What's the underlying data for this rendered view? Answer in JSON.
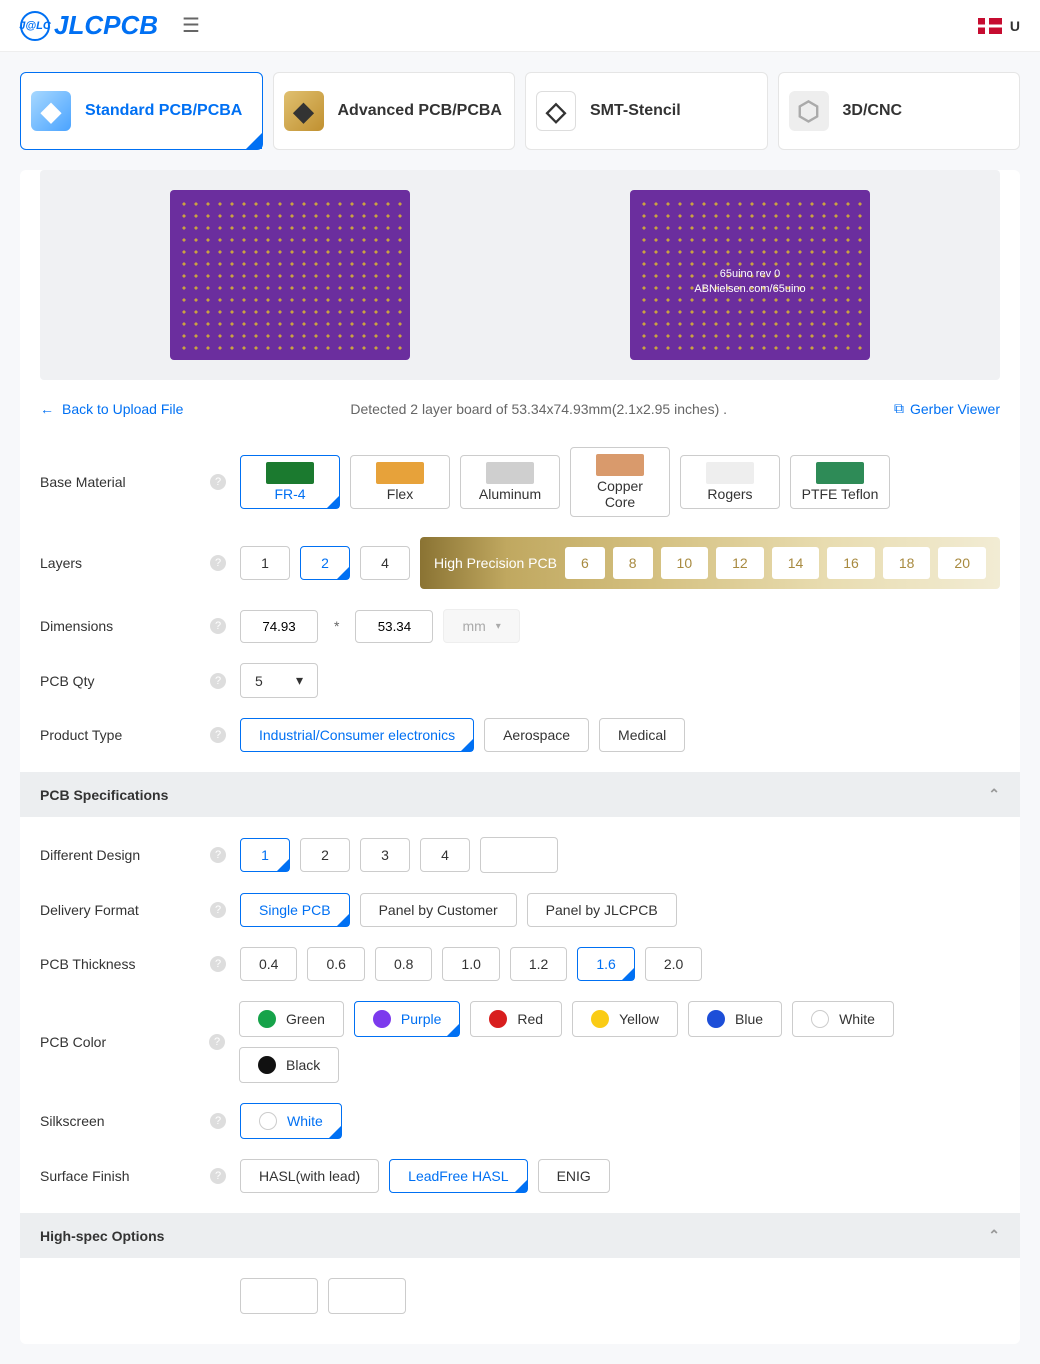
{
  "header": {
    "logo": "JLCPCB",
    "right": "U"
  },
  "tabs": [
    {
      "label": "Standard PCB/PCBA",
      "selected": true
    },
    {
      "label": "Advanced PCB/PCBA",
      "selected": false
    },
    {
      "label": "SMT-Stencil",
      "selected": false
    },
    {
      "label": "3D/CNC",
      "selected": false
    }
  ],
  "preview": {
    "rev_line1": "65uino rev 0",
    "rev_line2": "ABNielsen.com/65uino"
  },
  "meta": {
    "back": "Back to Upload File",
    "detected": "Detected 2 layer board of 53.34x74.93mm(2.1x2.95 inches) .",
    "viewer": "Gerber Viewer"
  },
  "materials_label": "Base Material",
  "materials": [
    {
      "label": "FR-4",
      "selected": true,
      "color": "#1b7a2f"
    },
    {
      "label": "Flex",
      "selected": false,
      "color": "#e7a23a"
    },
    {
      "label": "Aluminum",
      "selected": false,
      "color": "#cfcfcf"
    },
    {
      "label": "Copper Core",
      "selected": false,
      "color": "#d99a6c"
    },
    {
      "label": "Rogers",
      "selected": false,
      "color": "#eeeeee"
    },
    {
      "label": "PTFE Teflon",
      "selected": false,
      "color": "#2e8b57"
    }
  ],
  "layers_label": "Layers",
  "layers_basic": [
    "1",
    "2",
    "4"
  ],
  "layers_selected": "2",
  "layers_hp_label": "High Precision PCB",
  "layers_hp": [
    "6",
    "8",
    "10",
    "12",
    "14",
    "16",
    "18",
    "20"
  ],
  "dimensions": {
    "label": "Dimensions",
    "w": "74.93",
    "h": "53.34",
    "unit": "mm"
  },
  "qty": {
    "label": "PCB Qty",
    "value": "5"
  },
  "product_type": {
    "label": "Product Type",
    "options": [
      "Industrial/Consumer electronics",
      "Aerospace",
      "Medical"
    ],
    "selected": "Industrial/Consumer electronics"
  },
  "sections": {
    "spec": "PCB Specifications",
    "highspec": "High-spec Options"
  },
  "diff_design": {
    "label": "Different Design",
    "options": [
      "1",
      "2",
      "3",
      "4"
    ],
    "selected": "1"
  },
  "delivery": {
    "label": "Delivery Format",
    "options": [
      "Single PCB",
      "Panel by Customer",
      "Panel by JLCPCB"
    ],
    "selected": "Single PCB"
  },
  "thickness": {
    "label": "PCB Thickness",
    "options": [
      "0.4",
      "0.6",
      "0.8",
      "1.0",
      "1.2",
      "1.6",
      "2.0"
    ],
    "selected": "1.6"
  },
  "color": {
    "label": "PCB Color",
    "options": [
      {
        "label": "Green",
        "hex": "#16a34a"
      },
      {
        "label": "Purple",
        "hex": "#7c3aed"
      },
      {
        "label": "Red",
        "hex": "#d81e1e"
      },
      {
        "label": "Yellow",
        "hex": "#facc15"
      },
      {
        "label": "Blue",
        "hex": "#1d4ed8"
      },
      {
        "label": "White",
        "hex": "#ffffff"
      },
      {
        "label": "Black",
        "hex": "#111111"
      }
    ],
    "selected": "Purple"
  },
  "silkscreen": {
    "label": "Silkscreen",
    "options": [
      "White"
    ],
    "selected": "White"
  },
  "finish": {
    "label": "Surface Finish",
    "options": [
      "HASL(with lead)",
      "LeadFree HASL",
      "ENIG"
    ],
    "selected": "LeadFree HASL"
  }
}
